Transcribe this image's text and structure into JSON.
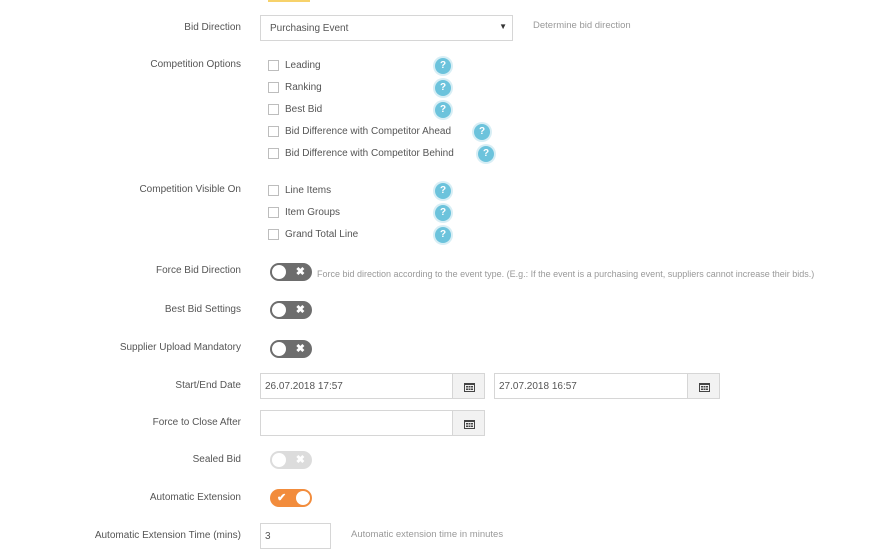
{
  "bid_direction": {
    "label": "Bid Direction",
    "value": "Purchasing Event",
    "hint": "Determine bid direction",
    "arrow_icon": "caret-down-icon"
  },
  "competition_options": {
    "label": "Competition Options",
    "items": [
      {
        "label": "Leading",
        "checked": false
      },
      {
        "label": "Ranking",
        "checked": false
      },
      {
        "label": "Best Bid",
        "checked": false
      },
      {
        "label": "Bid Difference with Competitor Ahead",
        "checked": false
      },
      {
        "label": "Bid Difference with Competitor Behind",
        "checked": false
      }
    ]
  },
  "competition_visible_on": {
    "label": "Competition Visible On",
    "items": [
      {
        "label": "Line Items",
        "checked": false
      },
      {
        "label": "Item Groups",
        "checked": false
      },
      {
        "label": "Grand Total Line",
        "checked": false
      }
    ]
  },
  "help_icon_text": "?",
  "force_bid_direction": {
    "label": "Force Bid Direction",
    "state": "off",
    "hint": "Force bid direction according to the event type. (E.g.: If the event is a purchasing event, suppliers cannot increase their bids.)"
  },
  "best_bid_settings": {
    "label": "Best Bid Settings",
    "state": "off"
  },
  "supplier_upload_mandatory": {
    "label": "Supplier Upload Mandatory",
    "state": "off"
  },
  "start_end_date": {
    "label": "Start/End Date",
    "start": "26.07.2018 17:57",
    "end": "27.07.2018 16:57",
    "icon": "calendar-icon"
  },
  "force_to_close_after": {
    "label": "Force to Close After",
    "value": ""
  },
  "sealed_bid": {
    "label": "Sealed Bid",
    "state": "off",
    "disabled": true
  },
  "automatic_extension": {
    "label": "Automatic Extension",
    "state": "on"
  },
  "automatic_extension_time": {
    "label": "Automatic Extension Time (mins)",
    "value": "3",
    "hint": "Automatic extension time in minutes"
  },
  "toggle_marks": {
    "off": "✖",
    "on": "✔"
  },
  "colors": {
    "toggle_off": "#6d6d6d",
    "toggle_on": "#f28c3c",
    "toggle_disabled": "#dcdcdc",
    "help": "#6cc3dc"
  }
}
